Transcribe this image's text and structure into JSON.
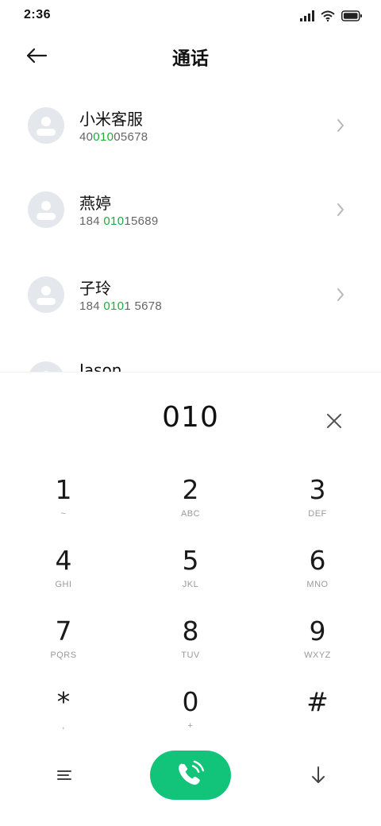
{
  "status_bar": {
    "time": "2:36"
  },
  "header": {
    "title": "通话"
  },
  "contacts": [
    {
      "name": "小米客服",
      "number_pre": "40",
      "number_match": "010",
      "number_post": "05678"
    },
    {
      "name": "燕婷",
      "number_pre": "184 ",
      "number_match": "010",
      "number_post": "15689"
    },
    {
      "name": "子玲",
      "number_pre": "184 ",
      "number_match": "010",
      "number_post": "1 5678"
    },
    {
      "name": "Jason",
      "number_pre": "",
      "number_match": "",
      "number_post": ""
    }
  ],
  "dialpad": {
    "input": "010",
    "keys": [
      {
        "digit": "1",
        "letters": "~"
      },
      {
        "digit": "2",
        "letters": "ABC"
      },
      {
        "digit": "3",
        "letters": "DEF"
      },
      {
        "digit": "4",
        "letters": "GHI"
      },
      {
        "digit": "5",
        "letters": "JKL"
      },
      {
        "digit": "6",
        "letters": "MNO"
      },
      {
        "digit": "7",
        "letters": "PQRS"
      },
      {
        "digit": "8",
        "letters": "TUV"
      },
      {
        "digit": "9",
        "letters": "WXYZ"
      },
      {
        "digit": "*",
        "letters": ","
      },
      {
        "digit": "0",
        "letters": "+"
      },
      {
        "digit": "#",
        "letters": ""
      }
    ]
  },
  "colors": {
    "accent_green": "#1aad3c",
    "call_button": "#12c47a",
    "avatar_bg": "#e4e7ec"
  },
  "icons": {
    "back": "arrow-left-icon",
    "chevron": "chevron-right-icon",
    "clear": "close-icon",
    "menu": "menu-lines-icon",
    "call": "phone-icon",
    "collapse": "arrow-down-icon"
  }
}
